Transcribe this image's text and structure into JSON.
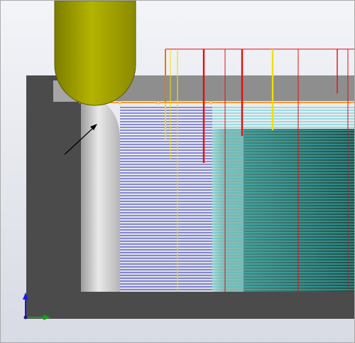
{
  "viewport": {
    "colors": {
      "background_top": "#f3f4f8",
      "background_bottom": "#d8dbe4",
      "part_dark": "#4b4b4b",
      "part_light": "#8e8e8e",
      "wall_face": "#cfcfcf",
      "tool_body": "#a8a800",
      "tool_tip": "#8f8f00",
      "toolpath_blue": "#2a2ab8",
      "toolpath_cyan": "#3cc8c8",
      "plunge_red": "#e01010",
      "plunge_yellow": "#f0e000",
      "rapid_orange": "#ff9a2a",
      "pocket_floor": "#2c7c74",
      "arrow": "#000000",
      "axis_y": "#1a1ae0",
      "axis_x": "#12a012"
    },
    "tool": {
      "name": "ball-nose-end-mill"
    },
    "annotation": {
      "name": "fillet-pointer-arrow"
    },
    "triad": {
      "name": "view-orientation-triad",
      "x_axis_color": "#12a012",
      "y_axis_color": "#1a1ae0"
    }
  }
}
